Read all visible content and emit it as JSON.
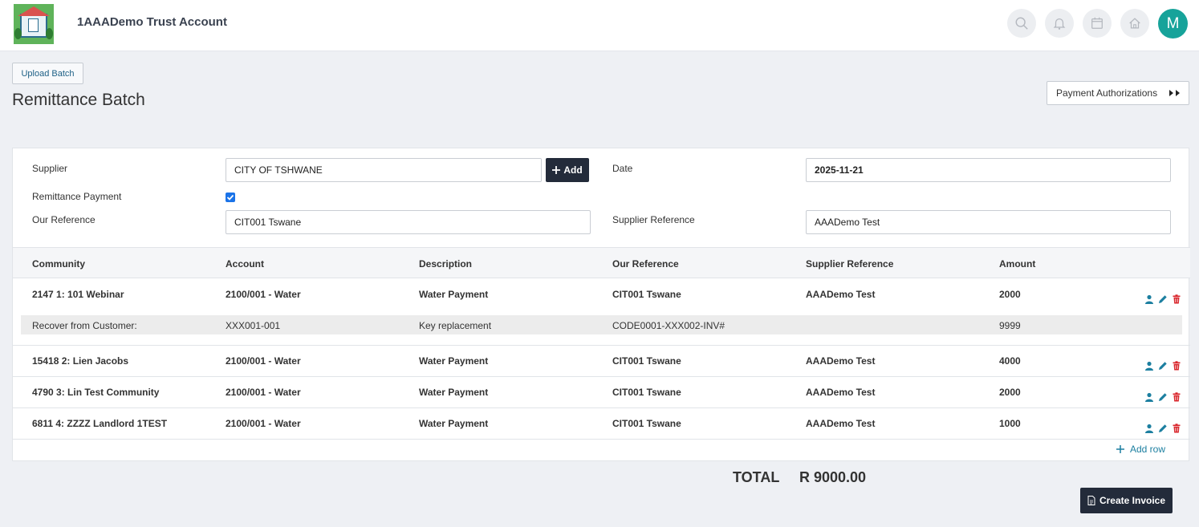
{
  "app": {
    "title": "1AAADemo Trust Account",
    "user_initial": "M"
  },
  "header": {
    "upload_label": "Upload Batch",
    "page_title": "Remittance Batch",
    "auth_label": "Payment Authorizations"
  },
  "form": {
    "supplier_label": "Supplier",
    "supplier_value": "CITY OF TSHWANE",
    "add_label": "Add",
    "date_label": "Date",
    "date_value": "2025-11-21",
    "remittance_label": "Remittance Payment",
    "remittance_checked": true,
    "our_ref_label": "Our Reference",
    "our_ref_value": "CIT001 Tswane",
    "supplier_ref_label": "Supplier Reference",
    "supplier_ref_value": "AAADemo Test"
  },
  "table": {
    "headers": [
      "Community",
      "Account",
      "Description",
      "Our Reference",
      "Supplier Reference",
      "Amount"
    ],
    "rows": [
      [
        "2147 1: 101 Webinar",
        "2100/001 - Water",
        "Water Payment",
        "CIT001 Tswane",
        "AAADemo Test",
        "2000"
      ],
      [
        "15418 2: Lien Jacobs",
        "2100/001 - Water",
        "Water Payment",
        "CIT001 Tswane",
        "AAADemo Test",
        "4000"
      ],
      [
        "4790 3: Lin Test Community",
        "2100/001 - Water",
        "Water Payment",
        "CIT001 Tswane",
        "AAADemo Test",
        "2000"
      ],
      [
        "6811 4: ZZZZ Landlord 1TEST",
        "2100/001 - Water",
        "Water Payment",
        "CIT001 Tswane",
        "AAADemo Test",
        "1000"
      ]
    ],
    "recover_row": [
      "Recover from Customer:",
      "XXX001-001",
      "Key replacement",
      "CODE0001-XXX002-INV#",
      "",
      "9999"
    ],
    "add_row_label": "Add row"
  },
  "totals": {
    "label": "TOTAL",
    "value": "R 9000.00"
  },
  "create_label": "Create Invoice",
  "colors": {
    "accent": "#17a39a",
    "dark_button": "#232b3a",
    "link": "#1c7fa0",
    "delete": "#d9252b"
  }
}
